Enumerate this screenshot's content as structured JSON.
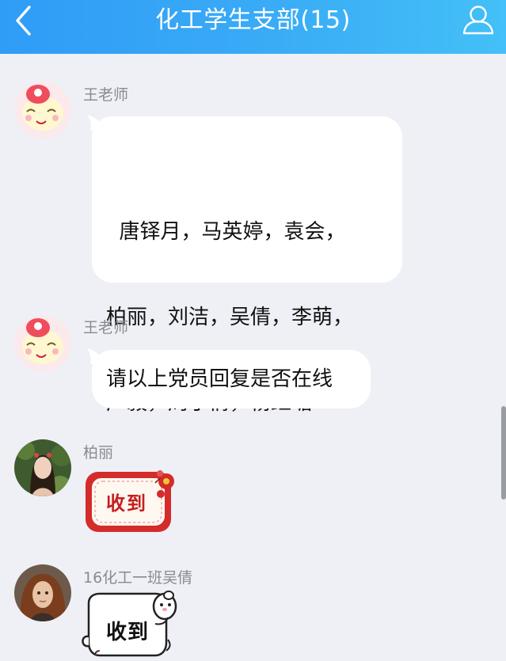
{
  "header": {
    "title": "化工学生支部(15)",
    "back_icon": "chevron-left-icon",
    "members_icon": "person-icon",
    "gradient": [
      "#2f9cf6",
      "#43c0f7"
    ]
  },
  "messages": [
    {
      "sender": "王老师",
      "lines": [
        "  唐铎月，马英婷，袁会，",
        "柏丽，刘洁，吴倩，李萌，",
        "广毅，周于倩，杨红嵋"
      ]
    },
    {
      "sender": "王老师",
      "text": "请以上党员回复是否在线"
    },
    {
      "sender": "柏丽",
      "sticker_text": "收到",
      "sticker_color": "#d42b2b"
    },
    {
      "sender": "16化工一班吴倩",
      "sticker_text": "收到"
    }
  ]
}
